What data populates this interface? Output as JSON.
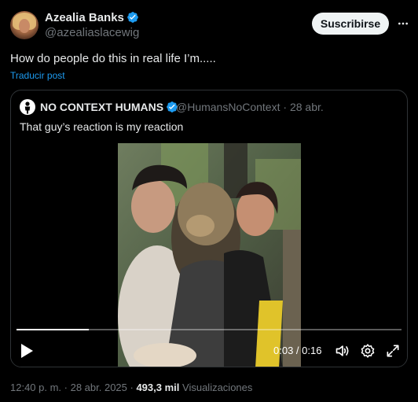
{
  "author": {
    "name": "Azealia Banks",
    "handle": "@azealiaslacewig"
  },
  "subscribe_label": "Suscribirse",
  "tweet_text": "How do people do this in real life I’m.....",
  "translate_label": "Traducir post",
  "quote": {
    "name": "NO CONTEXT HUMANS",
    "handle": "@HumansNoContext",
    "date": "· 28 abr.",
    "text": "That guy’s reaction is my reaction"
  },
  "video": {
    "time": "0:03 / 0:16",
    "progress_fraction": 0.1875
  },
  "meta": {
    "timestamp": "12:40 p. m. · 28 abr. 2025 ·",
    "views_count": "493,3 mil",
    "views_label": "Visualizaciones"
  },
  "colors": {
    "accent": "#1d9bf0",
    "background": "#000000",
    "muted": "#71767b"
  }
}
